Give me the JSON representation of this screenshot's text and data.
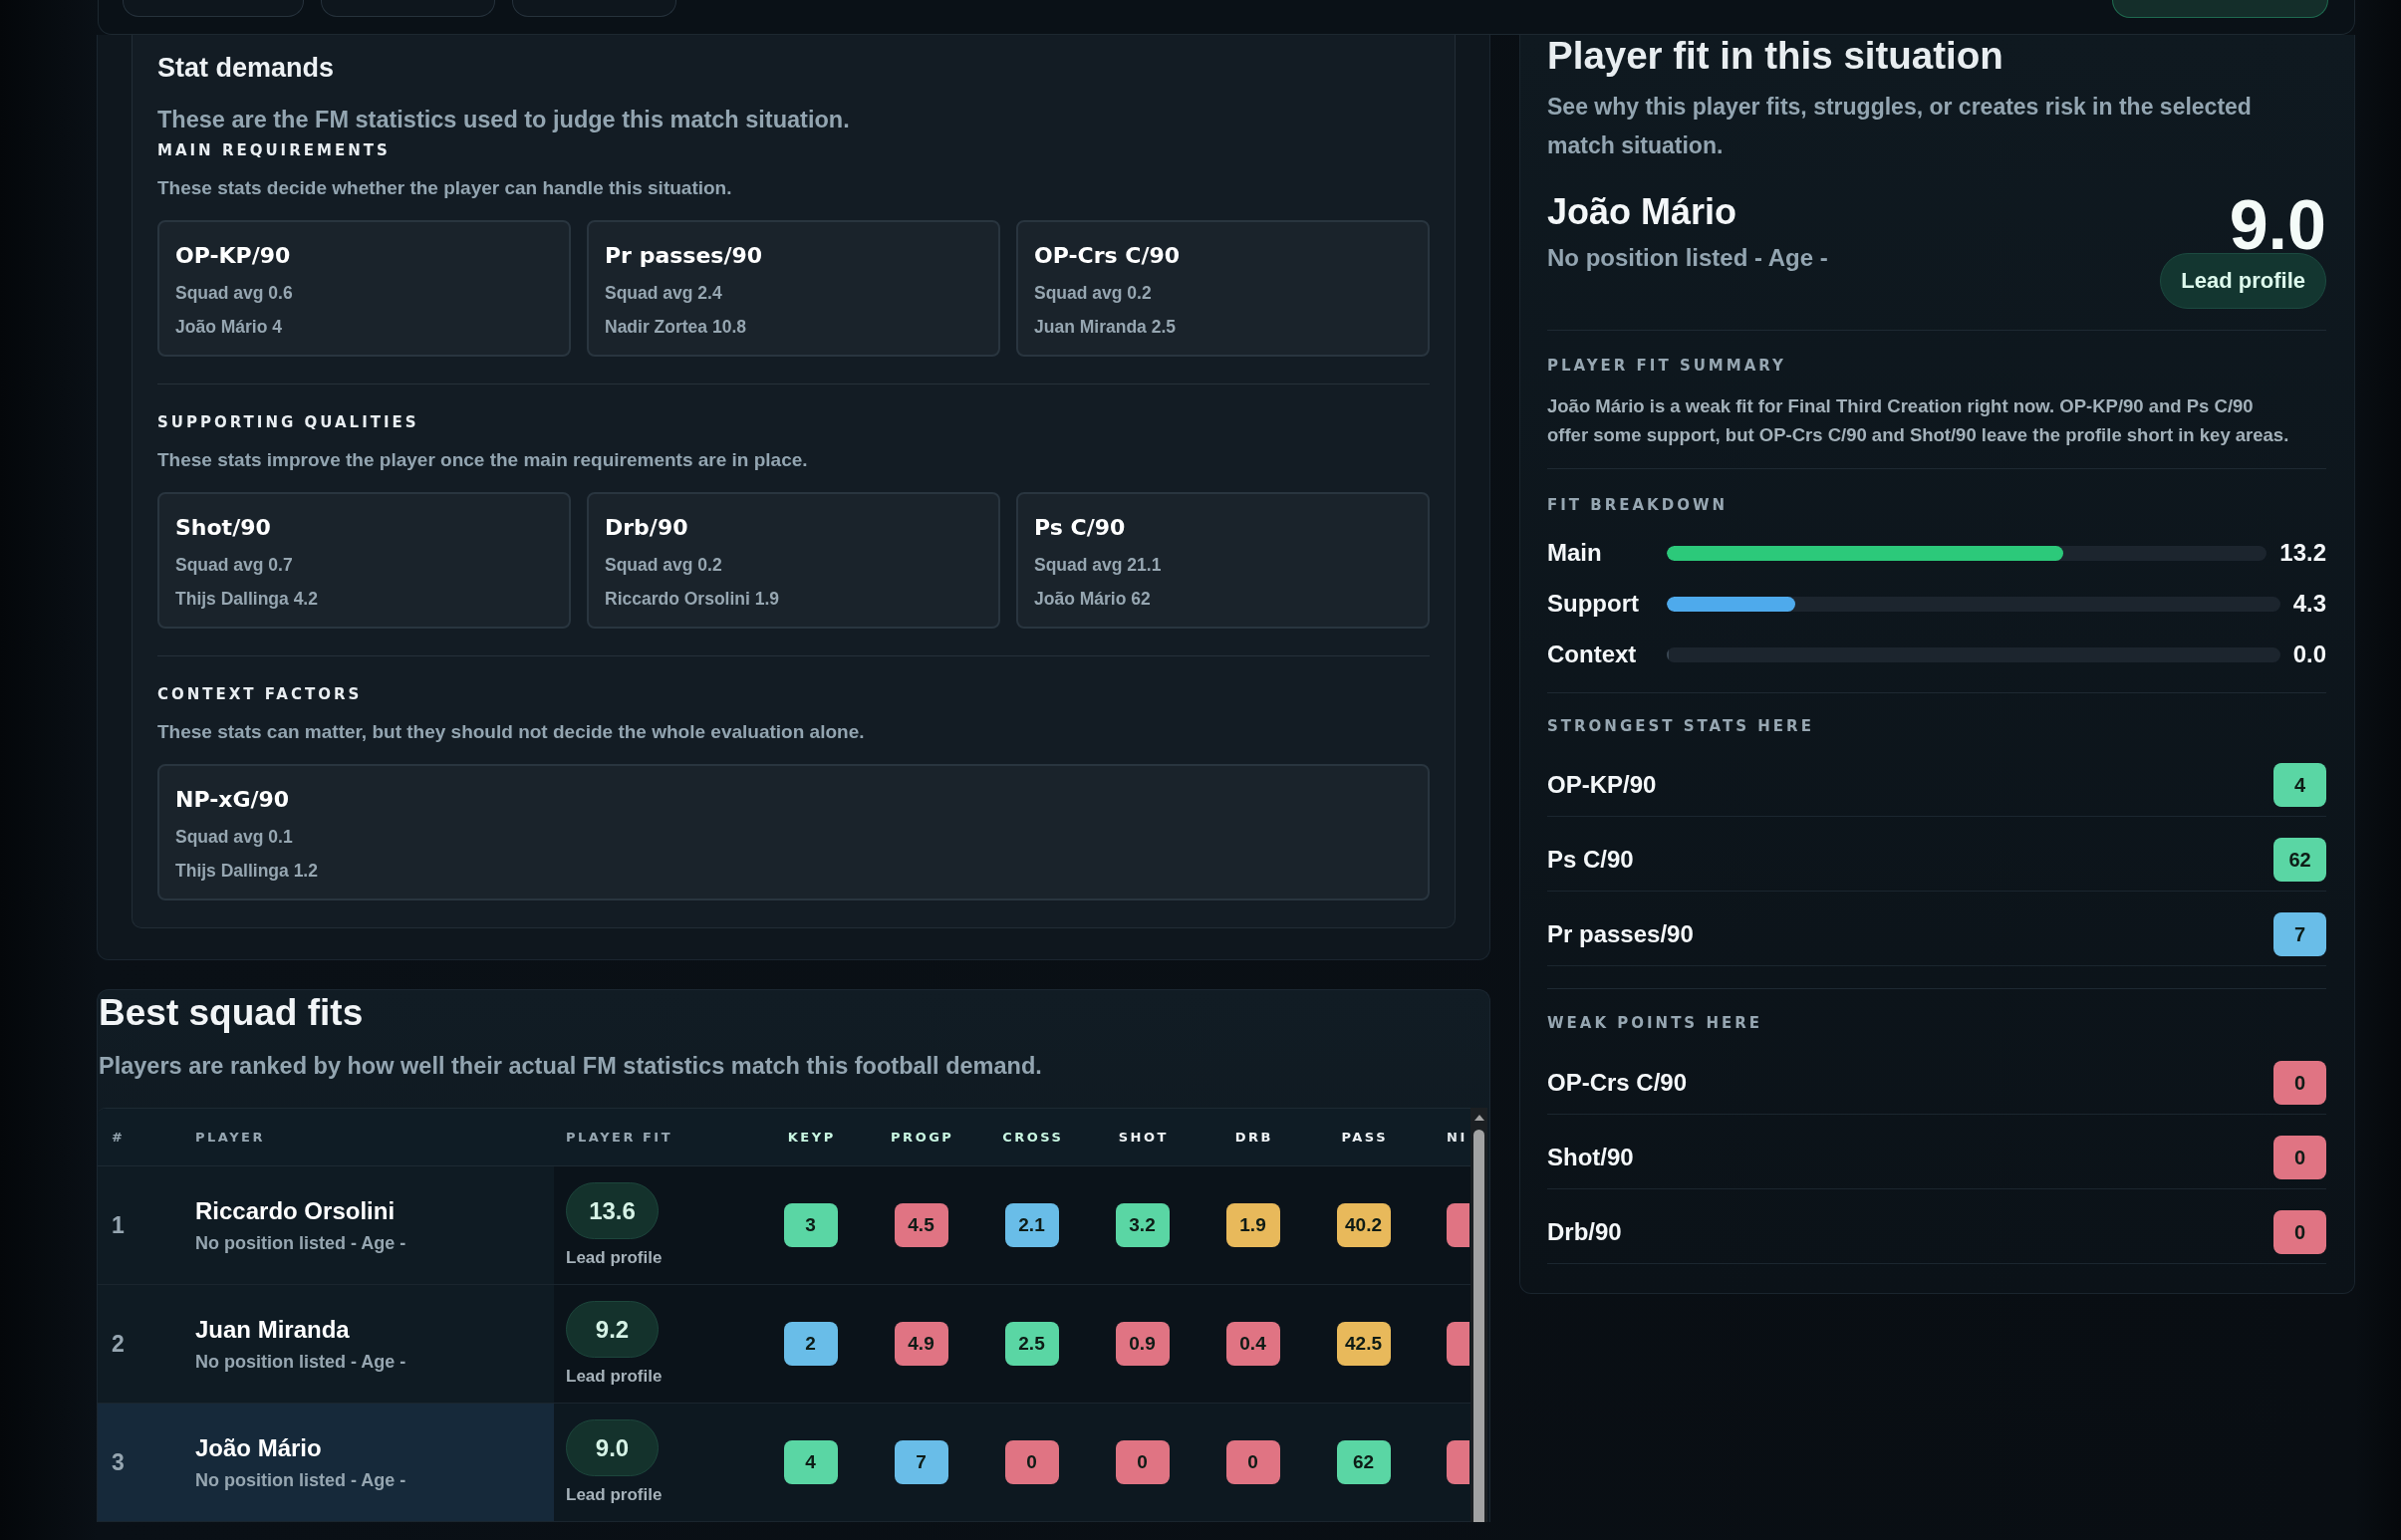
{
  "stat_demands": {
    "title": "Stat demands",
    "intro": "These are the FM statistics used to judge this match situation.",
    "groups": [
      {
        "heading": "MAIN REQUIREMENTS",
        "description": "These stats decide whether the player can handle this situation.",
        "stats": [
          {
            "name": "OP-KP/90",
            "squad_avg": "Squad avg 0.6",
            "leader": "João Mário 4"
          },
          {
            "name": "Pr passes/90",
            "squad_avg": "Squad avg 2.4",
            "leader": "Nadir Zortea 10.8"
          },
          {
            "name": "OP-Crs C/90",
            "squad_avg": "Squad avg 0.2",
            "leader": "Juan Miranda 2.5"
          }
        ]
      },
      {
        "heading": "SUPPORTING QUALITIES",
        "description": "These stats improve the player once the main requirements are in place.",
        "stats": [
          {
            "name": "Shot/90",
            "squad_avg": "Squad avg 0.7",
            "leader": "Thijs Dallinga 4.2"
          },
          {
            "name": "Drb/90",
            "squad_avg": "Squad avg 0.2",
            "leader": "Riccardo Orsolini 1.9"
          },
          {
            "name": "Ps C/90",
            "squad_avg": "Squad avg 21.1",
            "leader": "João Mário 62"
          }
        ]
      },
      {
        "heading": "CONTEXT FACTORS",
        "description": "These stats can matter, but they should not decide the whole evaluation alone.",
        "stats": [
          {
            "name": "NP-xG/90",
            "squad_avg": "Squad avg 0.1",
            "leader": "Thijs Dallinga 1.2"
          }
        ]
      }
    ]
  },
  "player_fit": {
    "title": "Player fit in this situation",
    "subtitle": "See why this player fits, struggles, or creates risk in the selected match situation.",
    "player": {
      "name": "João Mário",
      "meta": "No position listed - Age -",
      "score": "9.0",
      "profile": "Lead profile"
    },
    "summary": {
      "heading": "PLAYER FIT SUMMARY",
      "text": "João Mário is a weak fit for Final Third Creation right now. OP-KP/90 and Ps C/90 offer some support, but OP-Crs C/90 and Shot/90 leave the profile short in key areas."
    },
    "breakdown": {
      "heading": "FIT BREAKDOWN",
      "rows": [
        {
          "label": "Main",
          "level": 0.66,
          "color": "#2cc97a",
          "value": "13.2"
        },
        {
          "label": "Support",
          "level": 0.21,
          "color": "#4eaaec",
          "value": "4.3"
        },
        {
          "label": "Context",
          "level": 0,
          "value": "0.0"
        }
      ]
    },
    "strongest": {
      "heading": "STRONGEST STATS HERE",
      "items": [
        {
          "stat": "OP-KP/90",
          "value": "4",
          "color": "#5ad6a4"
        },
        {
          "stat": "Ps C/90",
          "value": "62",
          "color": "#5ad6a4"
        },
        {
          "stat": "Pr passes/90",
          "value": "7",
          "color": "#69bde8"
        }
      ]
    },
    "weak": {
      "heading": "WEAK POINTS HERE",
      "items": [
        {
          "stat": "OP-Crs C/90",
          "value": "0",
          "color": "#e07483"
        },
        {
          "stat": "Shot/90",
          "value": "0",
          "color": "#e07483"
        },
        {
          "stat": "Drb/90",
          "value": "0",
          "color": "#e07483"
        }
      ]
    }
  },
  "best_squad_fits": {
    "title": "Best squad fits",
    "subtitle": "Players are ranked by how well their actual FM statistics match this football demand.",
    "table": {
      "columns": [
        {
          "label": "#",
          "kind": "info"
        },
        {
          "label": "PLAYER",
          "kind": "info"
        },
        {
          "label": "PLAYER FIT",
          "kind": "info"
        },
        {
          "label": "KEYP",
          "kind": "main"
        },
        {
          "label": "PROGP",
          "kind": "main"
        },
        {
          "label": "CROSS",
          "kind": "main"
        },
        {
          "label": "SHOT",
          "kind": "support"
        },
        {
          "label": "DRB",
          "kind": "support"
        },
        {
          "label": "PASS",
          "kind": "support"
        },
        {
          "label": "NI",
          "kind": "context"
        }
      ],
      "rows": [
        {
          "rank": "1",
          "name": "Riccardo Orsolini",
          "meta": "No position listed - Age -",
          "fit": "13.6",
          "fit_label": "Lead profile",
          "selected": false,
          "stats": [
            {
              "value": "3",
              "color": "#5ad6a4"
            },
            {
              "value": "4.5",
              "color": "#e07483"
            },
            {
              "value": "2.1",
              "color": "#69bde8"
            },
            {
              "value": "3.2",
              "color": "#5ad6a4"
            },
            {
              "value": "1.9",
              "color": "#e8b95b"
            },
            {
              "value": "40.2",
              "color": "#e8b95b"
            },
            {
              "color": "#e07483"
            }
          ]
        },
        {
          "rank": "2",
          "name": "Juan Miranda",
          "meta": "No position listed - Age -",
          "fit": "9.2",
          "fit_label": "Lead profile",
          "selected": false,
          "stats": [
            {
              "value": "2",
              "color": "#69bde8"
            },
            {
              "value": "4.9",
              "color": "#e07483"
            },
            {
              "value": "2.5",
              "color": "#5ad6a4"
            },
            {
              "value": "0.9",
              "color": "#e07483"
            },
            {
              "value": "0.4",
              "color": "#e07483"
            },
            {
              "value": "42.5",
              "color": "#e8b95b"
            },
            {
              "color": "#e07483"
            }
          ]
        },
        {
          "rank": "3",
          "name": "João Mário",
          "meta": "No position listed - Age -",
          "fit": "9.0",
          "fit_label": "Lead profile",
          "selected": true,
          "stats": [
            {
              "value": "4",
              "color": "#5ad6a4"
            },
            {
              "value": "7",
              "color": "#69bde8"
            },
            {
              "value": "0",
              "color": "#e07483"
            },
            {
              "value": "0",
              "color": "#e07483"
            },
            {
              "value": "0",
              "color": "#e07483"
            },
            {
              "value": "62",
              "color": "#5ad6a4"
            },
            {
              "color": "#e07483"
            }
          ]
        }
      ]
    }
  }
}
